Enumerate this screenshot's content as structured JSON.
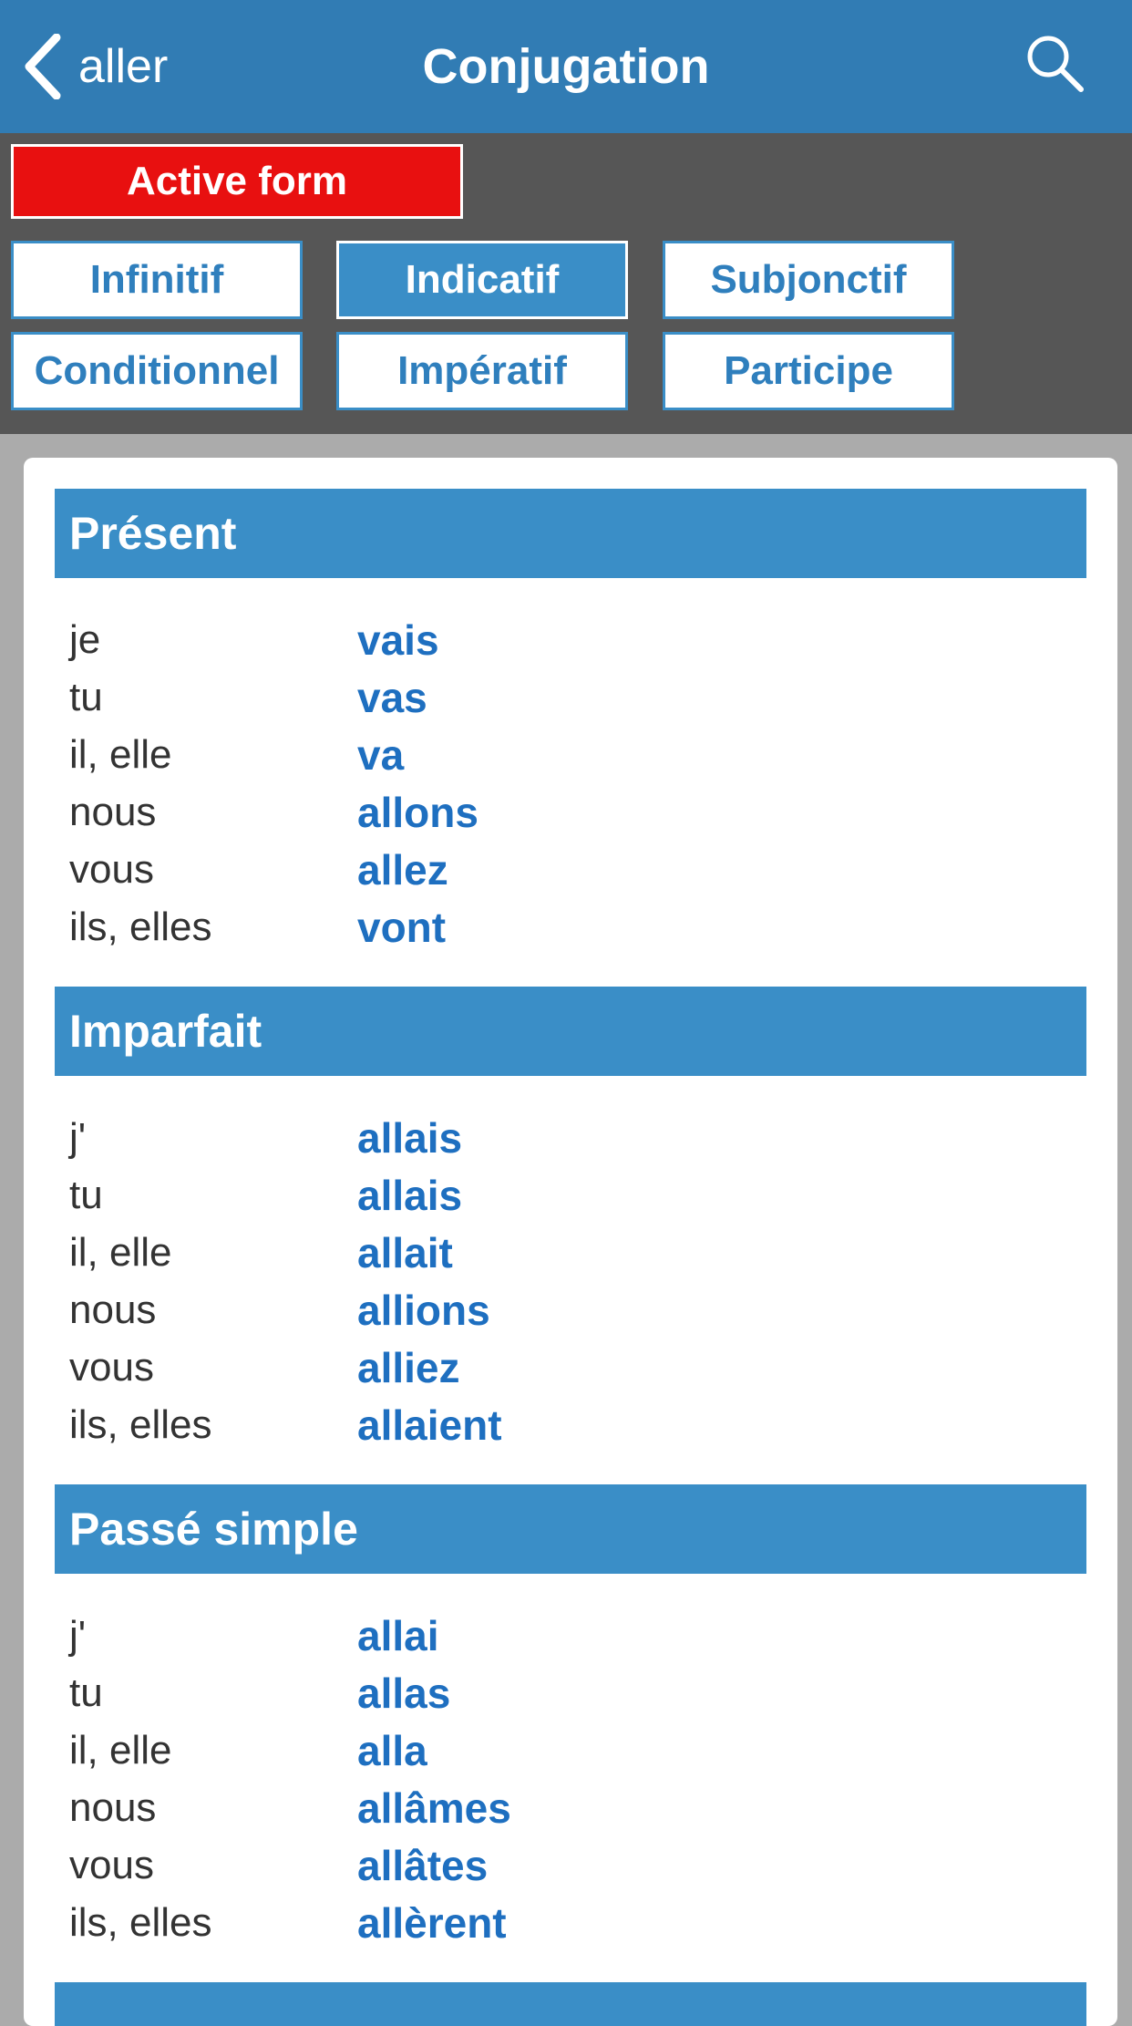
{
  "navbar": {
    "back_label": "aller",
    "title": "Conjugation",
    "back_icon": "chevron-left-icon",
    "search_icon": "search-icon"
  },
  "controls": {
    "active_form_label": "Active form",
    "modes": [
      {
        "label": "Infinitif",
        "selected": false
      },
      {
        "label": "Indicatif",
        "selected": true
      },
      {
        "label": "Subjonctif",
        "selected": false
      },
      {
        "label": "Conditionnel",
        "selected": false
      },
      {
        "label": "Impératif",
        "selected": false
      },
      {
        "label": "Participe",
        "selected": false
      }
    ]
  },
  "tenses": [
    {
      "name": "Présent",
      "rows": [
        {
          "pronoun": "je",
          "form": "vais"
        },
        {
          "pronoun": "tu",
          "form": "vas"
        },
        {
          "pronoun": "il, elle",
          "form": "va"
        },
        {
          "pronoun": "nous",
          "form": "allons"
        },
        {
          "pronoun": "vous",
          "form": "allez"
        },
        {
          "pronoun": "ils, elles",
          "form": "vont"
        }
      ]
    },
    {
      "name": "Imparfait",
      "rows": [
        {
          "pronoun": "j'",
          "form": "allais"
        },
        {
          "pronoun": "tu",
          "form": "allais"
        },
        {
          "pronoun": "il, elle",
          "form": "allait"
        },
        {
          "pronoun": "nous",
          "form": "allions"
        },
        {
          "pronoun": "vous",
          "form": "alliez"
        },
        {
          "pronoun": "ils, elles",
          "form": "allaient"
        }
      ]
    },
    {
      "name": "Passé simple",
      "rows": [
        {
          "pronoun": "j'",
          "form": "allai"
        },
        {
          "pronoun": "tu",
          "form": "allas"
        },
        {
          "pronoun": "il, elle",
          "form": "alla"
        },
        {
          "pronoun": "nous",
          "form": "allâmes"
        },
        {
          "pronoun": "vous",
          "form": "allâtes"
        },
        {
          "pronoun": "ils, elles",
          "form": "allèrent"
        }
      ]
    }
  ],
  "colors": {
    "navbar": "#317cb4",
    "controls_bg": "#565656",
    "active_form": "#e81010",
    "accent": "#3a8ec7",
    "verb_text": "#1e6fc0"
  }
}
